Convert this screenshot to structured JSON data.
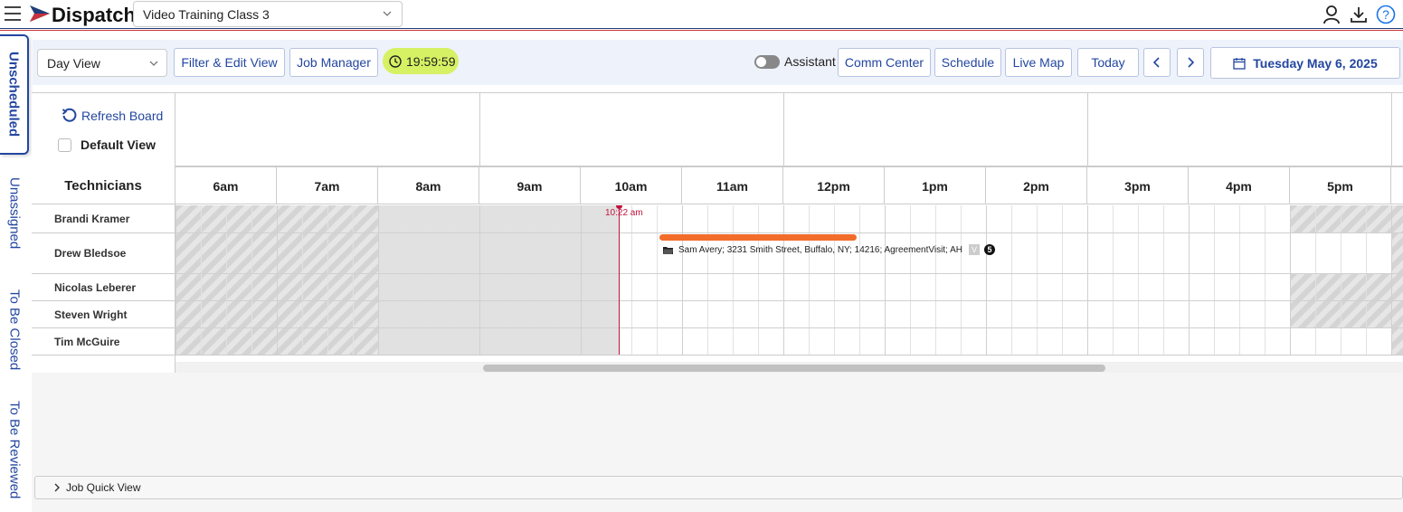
{
  "header": {
    "app_name": "Dispatch",
    "selected_class": "Video Training Class 3",
    "icons": [
      "menu-icon",
      "user-icon",
      "download-icon",
      "help-icon"
    ]
  },
  "toolbar": {
    "view_select": "Day View",
    "filter_edit_view": "Filter & Edit View",
    "job_manager": "Job Manager",
    "timer": "19:59:59",
    "assistant_label": "Assistant",
    "comm_center": "Comm Center",
    "schedule": "Schedule",
    "live_map": "Live Map",
    "today": "Today",
    "date": "Tuesday May 6, 2025"
  },
  "side_tabs": [
    "Unscheduled",
    "Unassigned",
    "To Be Closed",
    "To Be Reviewed"
  ],
  "board": {
    "refresh": "Refresh Board",
    "default_view": "Default View",
    "technicians_header": "Technicians",
    "hours": [
      "6am",
      "7am",
      "8am",
      "9am",
      "10am",
      "11am",
      "12pm",
      "1pm",
      "2pm",
      "3pm",
      "4pm",
      "5pm"
    ],
    "now_label": "10:22 am",
    "technicians": [
      "Brandi Kramer",
      "Drew Bledsoe",
      "Nicolas Leberer",
      "Steven Wright",
      "Tim McGuire"
    ],
    "job": {
      "text": "Sam Avery; 3231 Smith Street, Buffalo, NY; 14216; AgreementVisit; AH",
      "badge_v": "V",
      "badge_n": "5",
      "color": "#f26c2a"
    }
  },
  "quick_view": "Job Quick View",
  "colors": {
    "accent": "#2346a0",
    "now_line": "#c0143c",
    "timer_bg": "#d6f163"
  }
}
